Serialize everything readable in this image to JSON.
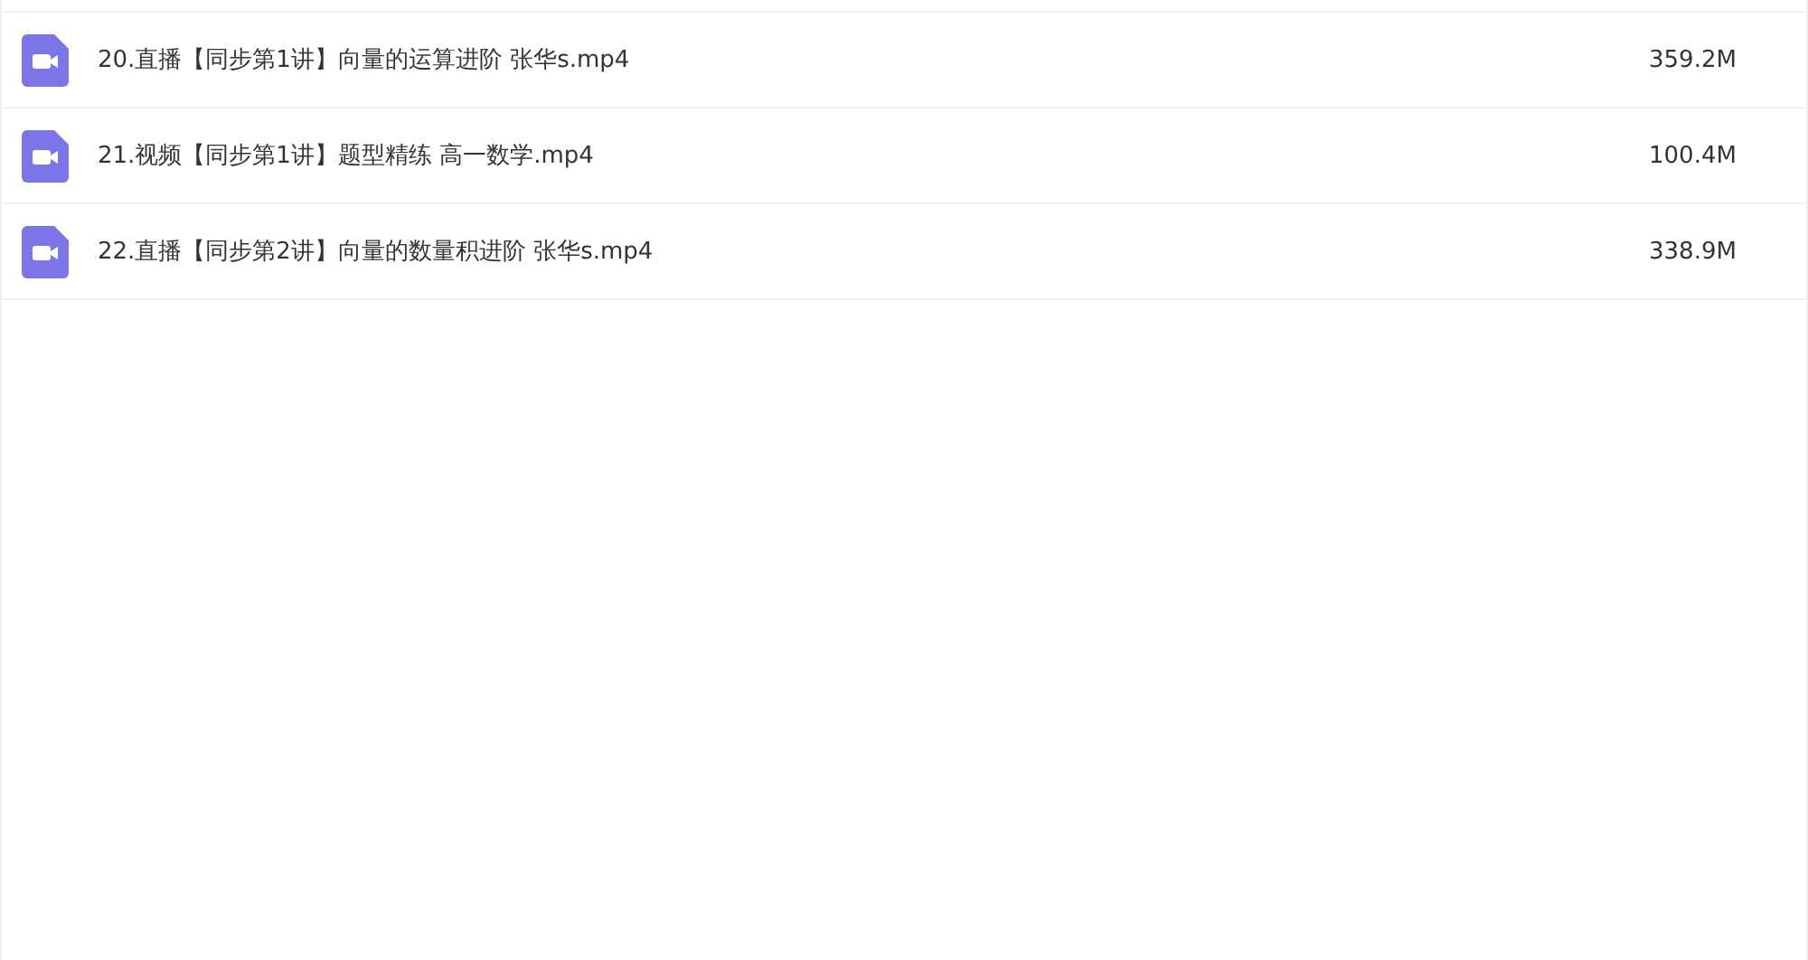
{
  "files": [
    {
      "name": "20.直播【同步第1讲】向量的运算进阶 张华s.mp4",
      "size": "359.2M"
    },
    {
      "name": "21.视频【同步第1讲】题型精练 高一数学.mp4",
      "size": "100.4M"
    },
    {
      "name": "22.直播【同步第2讲】向量的数量积进阶 张华s.mp4",
      "size": "338.9M"
    }
  ]
}
